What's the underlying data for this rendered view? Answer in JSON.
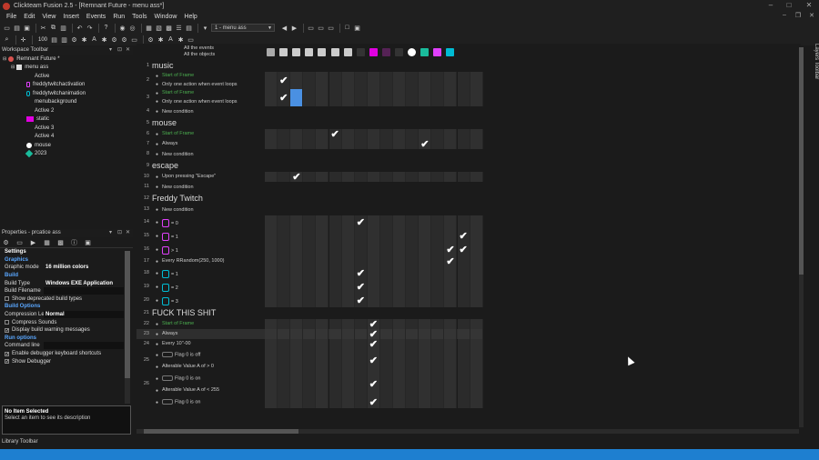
{
  "window": {
    "title": "Clickteam Fusion 2.5 - [Remnant Future - menu ass*]"
  },
  "menu": [
    "File",
    "Edit",
    "View",
    "Insert",
    "Events",
    "Run",
    "Tools",
    "Window",
    "Help"
  ],
  "toolbar": {
    "frame_select": "1 - menu ass",
    "zoom": "100"
  },
  "workspace": {
    "title": "Workspace Toolbar",
    "app": "Remnant Future *",
    "frame": "menu ass",
    "objects": [
      {
        "name": "Active",
        "icon": "none"
      },
      {
        "name": "freddytwitchactivation",
        "icon": "pink-rect"
      },
      {
        "name": "freddytwitchanimation",
        "icon": "teal-rect"
      },
      {
        "name": "menubackground",
        "icon": "none"
      },
      {
        "name": "Active 2",
        "icon": "none"
      },
      {
        "name": "static",
        "icon": "magenta-block"
      },
      {
        "name": "Active 3",
        "icon": "none"
      },
      {
        "name": "Active 4",
        "icon": "none"
      },
      {
        "name": "mouse",
        "icon": "white-circle"
      },
      {
        "name": "2023",
        "icon": "teal-diamond"
      }
    ]
  },
  "properties": {
    "title": "Properties - prcatice ass",
    "settings_label": "Settings",
    "graphics_label": "Graphics",
    "graphic_mode_label": "Graphic mode",
    "graphic_mode_value": "16 million colors",
    "build_label": "Build",
    "build_type_label": "Build Type",
    "build_type_value": "Windows EXE Application",
    "build_filename_label": "Build Filename",
    "show_deprecated": "Show deprecated build types",
    "build_options_label": "Build Options",
    "compression_label": "Compression Le",
    "compression_value": "Normal",
    "compress_sounds": "Compress Sounds",
    "display_warnings": "Display build warning messages",
    "run_options_label": "Run options",
    "command_line_label": "Command line",
    "enable_debugger_shortcuts": "Enable debugger keyboard shortcuts",
    "show_debugger": "Show Debugger",
    "desc_title": "No Item Selected",
    "desc_text": "Select an item to see its description"
  },
  "library_toolbar": "Library Toolbar",
  "layers_toolbar": "Layers Toolbar",
  "event_editor": {
    "header_all_events": "All the events",
    "header_all_objects": "All the objects",
    "rows": [
      {
        "num": "1",
        "kind": "group",
        "text": "music"
      },
      {
        "num": "2",
        "kind": "cond",
        "lines": [
          "Start of Frame",
          "Only one action when event loops"
        ],
        "green": [
          true,
          false
        ],
        "checks": [
          1
        ]
      },
      {
        "num": "3",
        "kind": "cond",
        "lines": [
          "Start of Frame",
          "Only one action when event loops"
        ],
        "green": [
          true,
          false
        ],
        "checks": [
          1
        ],
        "highlight": [
          2
        ]
      },
      {
        "num": "4",
        "kind": "new",
        "text": "New condition"
      },
      {
        "num": "5",
        "kind": "group",
        "text": "mouse"
      },
      {
        "num": "6",
        "kind": "cond",
        "lines": [
          "Start of Frame"
        ],
        "green": [
          true
        ],
        "checks": [
          5
        ]
      },
      {
        "num": "7",
        "kind": "cond",
        "lines": [
          "Always"
        ],
        "green": [
          false
        ],
        "checks": [
          12
        ]
      },
      {
        "num": "8",
        "kind": "new",
        "text": "New condition"
      },
      {
        "num": "9",
        "kind": "group",
        "text": "escape"
      },
      {
        "num": "10",
        "kind": "cond",
        "lines": [
          "Upon pressing \"Escape\""
        ],
        "green": [
          false
        ],
        "checks": [
          2
        ]
      },
      {
        "num": "11",
        "kind": "new",
        "text": "New condition"
      },
      {
        "num": "12",
        "kind": "group",
        "text": "Freddy Twitch"
      },
      {
        "num": "13",
        "kind": "new",
        "text": "New condition"
      },
      {
        "num": "14",
        "kind": "cond",
        "lines": [
          "= 0"
        ],
        "green": [
          false
        ],
        "checks": [
          7
        ],
        "icon": "pink"
      },
      {
        "num": "15",
        "kind": "cond",
        "lines": [
          "= 1"
        ],
        "green": [
          false
        ],
        "checks": [
          15
        ],
        "icon": "pink"
      },
      {
        "num": "16",
        "kind": "cond",
        "lines": [
          "> 1"
        ],
        "green": [
          false
        ],
        "checks": [
          14,
          15
        ],
        "icon": "pink"
      },
      {
        "num": "17",
        "kind": "cond",
        "lines": [
          "Every RRandom(250, 1000)"
        ],
        "green": [
          false
        ],
        "checks": [
          14
        ]
      },
      {
        "num": "18",
        "kind": "cond",
        "lines": [
          "= 1"
        ],
        "green": [
          false
        ],
        "checks": [
          7
        ],
        "icon": "teal"
      },
      {
        "num": "19",
        "kind": "cond",
        "lines": [
          "= 2"
        ],
        "green": [
          false
        ],
        "checks": [
          7
        ],
        "icon": "teal"
      },
      {
        "num": "20",
        "kind": "cond",
        "lines": [
          "= 3"
        ],
        "green": [
          false
        ],
        "checks": [
          7
        ],
        "icon": "teal"
      },
      {
        "num": "21",
        "kind": "group",
        "text": "FUCK THIS SHIT"
      },
      {
        "num": "22",
        "kind": "cond",
        "lines": [
          "Start of Frame"
        ],
        "green": [
          true
        ],
        "checks": [
          8
        ]
      },
      {
        "num": "23",
        "kind": "cond",
        "lines": [
          "Always"
        ],
        "green": [
          false
        ],
        "checks": [
          8
        ],
        "selected": true
      },
      {
        "num": "24",
        "kind": "cond",
        "lines": [
          "Every 10\"-00"
        ],
        "green": [
          false
        ],
        "checks": [
          8
        ]
      },
      {
        "num": "25",
        "kind": "cond",
        "lines": [
          "Flag 0 is off",
          "Alterable Value A of  > 0"
        ],
        "green": [
          false,
          false
        ],
        "checks": [
          8
        ],
        "icon": "box"
      },
      {
        "num": "26",
        "kind": "cond",
        "lines": [
          "Flag 0 is on",
          "Alterable Value A of  < 255"
        ],
        "green": [
          false,
          false
        ],
        "checks": [
          8
        ],
        "icon": "box"
      },
      {
        "num": "",
        "kind": "cond",
        "lines": [
          "Flag 0 is on"
        ],
        "green": [
          false
        ],
        "checks": [
          8
        ],
        "icon": "box"
      }
    ]
  }
}
